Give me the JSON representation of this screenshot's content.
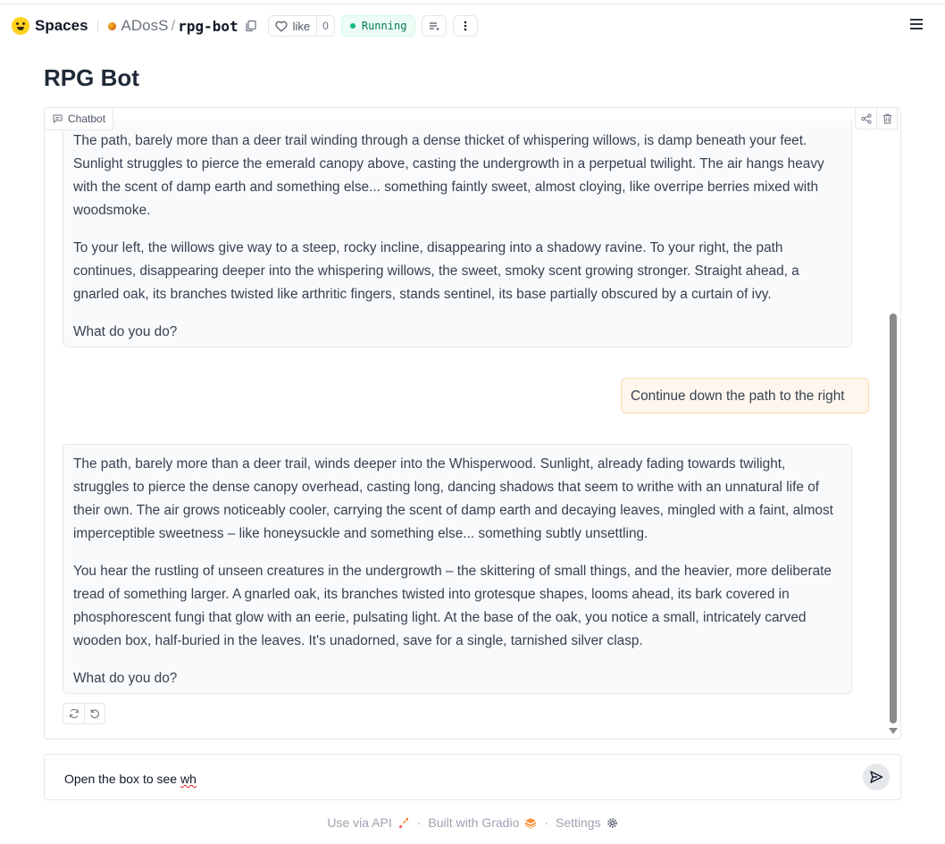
{
  "header": {
    "spaces_label": "Spaces",
    "owner": "ADosS",
    "separator": "/",
    "repo": "rpg-bot",
    "like_label": "like",
    "like_count": "0",
    "status": "Running",
    "status_color": "#10b981"
  },
  "page": {
    "title": "RPG Bot"
  },
  "chatbot": {
    "label": "Chatbot",
    "messages": [
      {
        "role": "bot",
        "paragraphs": [
          "The path, barely more than a deer trail winding through a dense thicket of whispering willows, is damp beneath your feet. Sunlight struggles to pierce the emerald canopy above, casting the undergrowth in a perpetual twilight. The air hangs heavy with the scent of damp earth and something else... something faintly sweet, almost cloying, like overripe berries mixed with woodsmoke.",
          "To your left, the willows give way to a steep, rocky incline, disappearing into a shadowy ravine. To your right, the path continues, disappearing deeper into the whispering willows, the sweet, smoky scent growing stronger. Straight ahead, a gnarled oak, its branches twisted like arthritic fingers, stands sentinel, its base partially obscured by a curtain of ivy.",
          "What do you do?"
        ]
      },
      {
        "role": "user",
        "text": "Continue down the path to the right"
      },
      {
        "role": "bot",
        "paragraphs": [
          "The path, barely more than a deer trail, winds deeper into the Whisperwood. Sunlight, already fading towards twilight, struggles to pierce the dense canopy overhead, casting long, dancing shadows that seem to writhe with an unnatural life of their own. The air grows noticeably cooler, carrying the scent of damp earth and decaying leaves, mingled with a faint, almost imperceptible sweetness – like honeysuckle and something else... something subtly unsettling.",
          "You hear the rustling of unseen creatures in the undergrowth – the skittering of small things, and the heavier, more deliberate tread of something larger. A gnarled oak, its branches twisted into grotesque shapes, looms ahead, its bark covered in phosphorescent fungi that glow with an eerie, pulsating light. At the base of the oak, you notice a small, intricately carved wooden box, half-buried in the leaves. It's unadorned, save for a single, tarnished silver clasp.",
          "What do you do?"
        ]
      }
    ]
  },
  "input": {
    "value_prefix": "Open the box to see ",
    "value_misspelled": "wh"
  },
  "footer": {
    "api": "Use via API",
    "built": "Built with Gradio",
    "settings": "Settings",
    "separator": "·"
  }
}
